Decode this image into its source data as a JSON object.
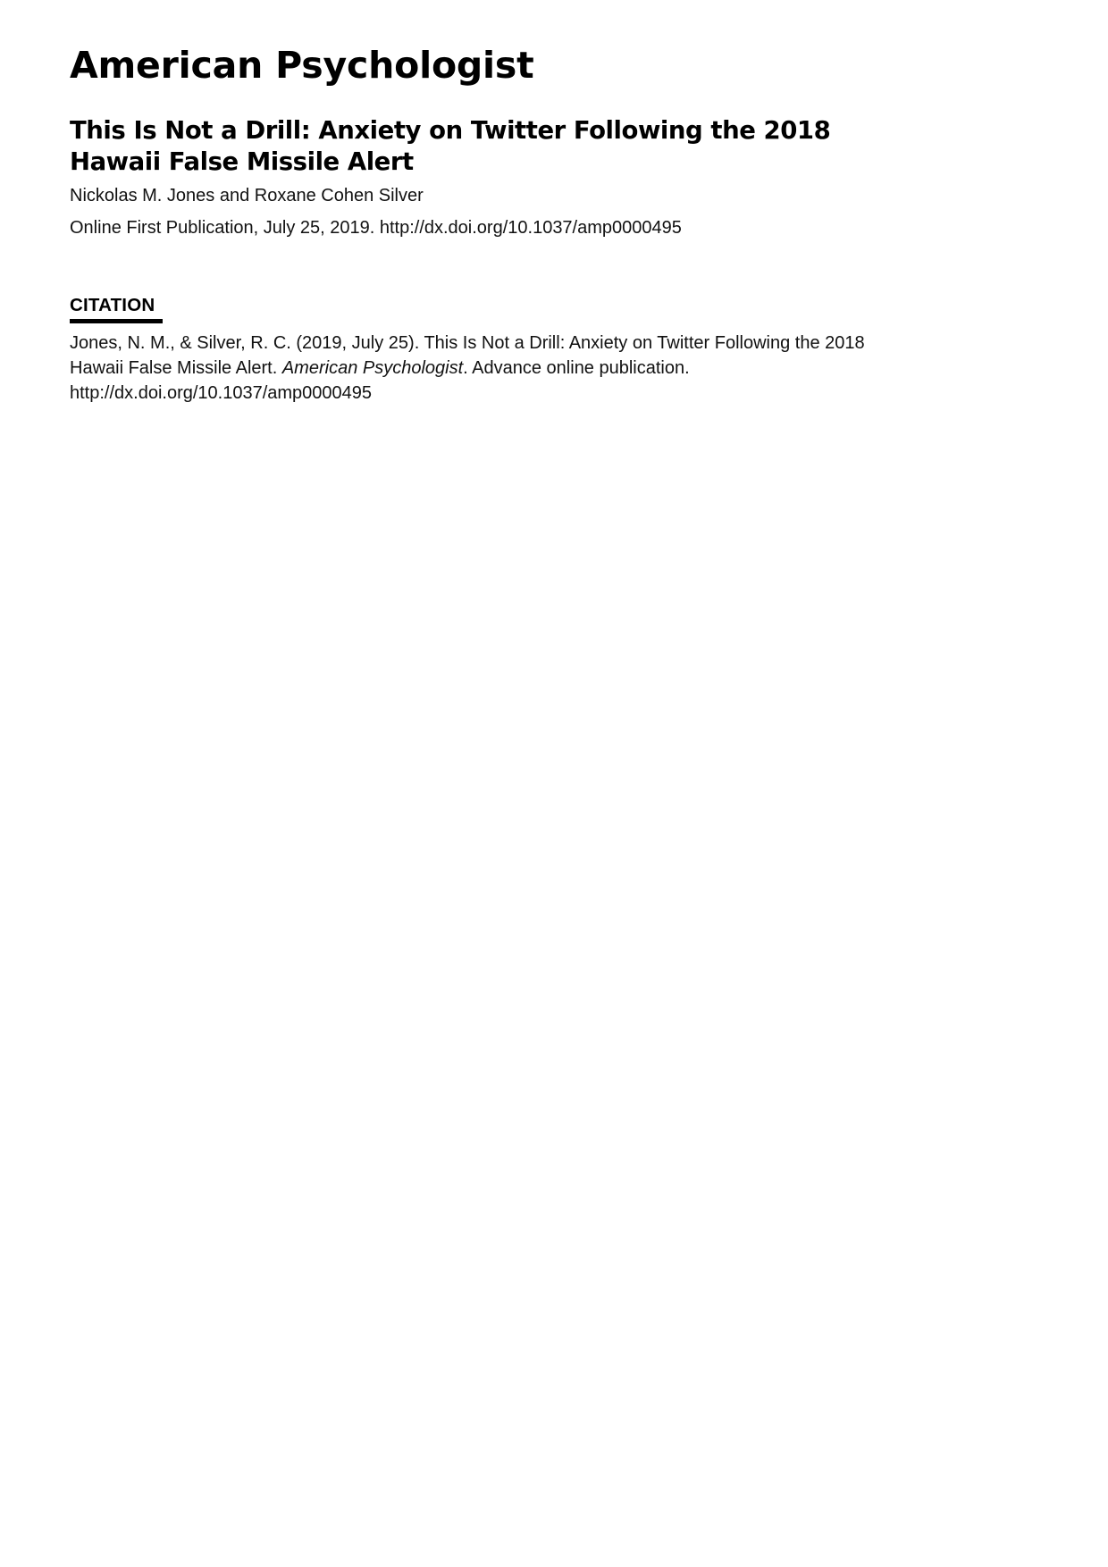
{
  "document": {
    "journal_name": "American Psychologist",
    "article": {
      "title_line_1": "This Is Not a Drill: Anxiety on Twitter Following the 2018",
      "title_line_2": "Hawaii False Missile Alert",
      "authors": "Nickolas M. Jones and Roxane Cohen Silver",
      "publication_info": "Online First Publication, July 25, 2019. http://dx.doi.org/10.1037/amp0000495"
    },
    "citation": {
      "heading": "CITATION",
      "line_1": "Jones, N. M., & Silver, R. C. (2019, July 25). This Is Not a Drill: Anxiety on Twitter Following the 2018",
      "line_2_before_italic": "Hawaii False Missile Alert. ",
      "line_2_italic": "American Psychologist",
      "line_2_after_italic": ". Advance online publication.",
      "line_3_doi": "http://dx.doi.org/10.1037/amp0000495"
    }
  },
  "colors": {
    "page_background": "#ffffff",
    "text": "#000000",
    "rule": "#000000"
  }
}
